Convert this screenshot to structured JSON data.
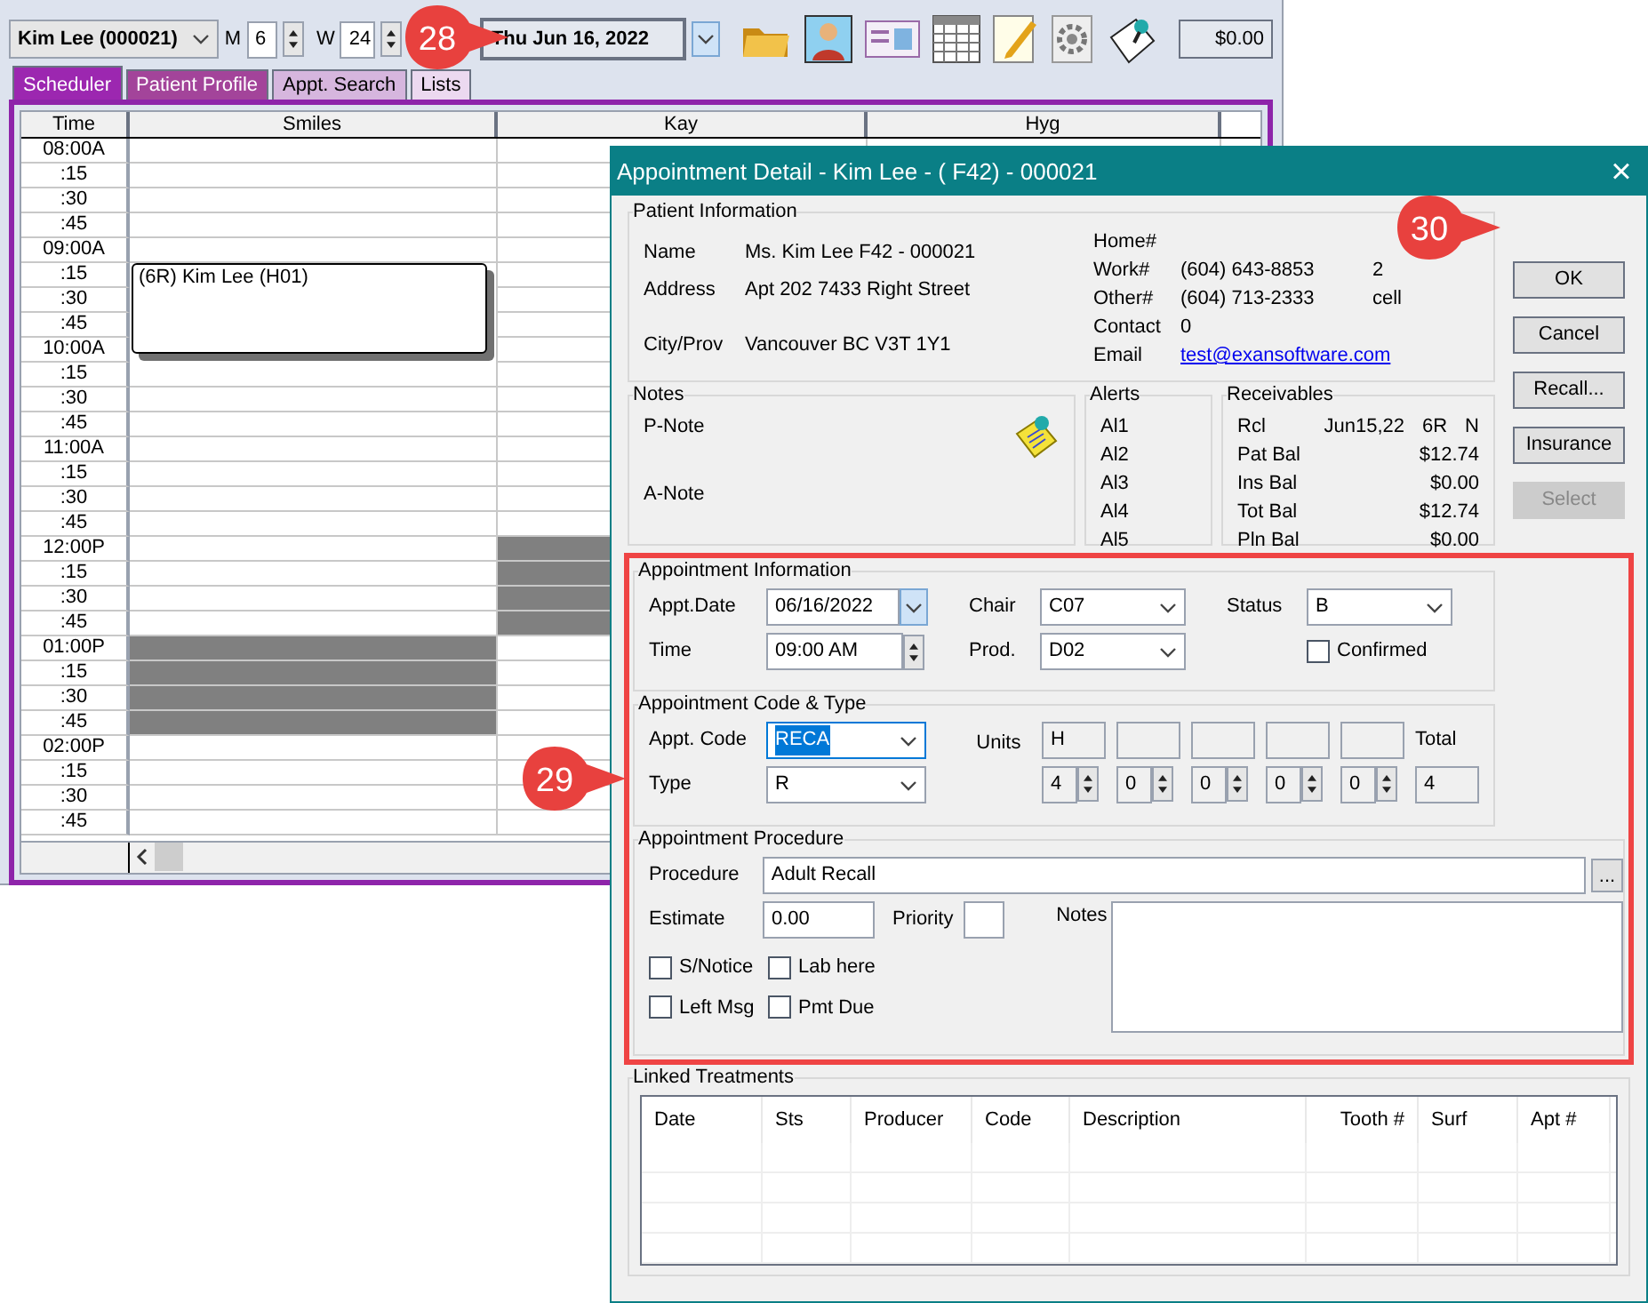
{
  "scheduler": {
    "patient_select": "Kim Lee (000021)",
    "m_label": "M",
    "m_value": "6",
    "w_label": "W",
    "w_value": "24",
    "date": "Thu  Jun 16, 2022",
    "balance": "$0.00",
    "tabs": [
      {
        "label": "Scheduler",
        "selected": true,
        "color": "#9c27b0"
      },
      {
        "label": "Patient Profile",
        "selected": false,
        "color": "#a3449a"
      },
      {
        "label": "Appt. Search",
        "selected": false,
        "color": "#d6b6de"
      },
      {
        "label": "Lists",
        "selected": false,
        "color": "#ecd9f0"
      }
    ],
    "columns": [
      "Time",
      "Smiles",
      "Kay",
      "Hyg"
    ],
    "rows": [
      {
        "time": "08:00A",
        "slots": [
          {
            "kind": "open"
          },
          {
            "kind": "open"
          }
        ]
      },
      {
        "time": ":15",
        "slots": [
          {
            "kind": "open"
          },
          {
            "kind": "open"
          }
        ]
      },
      {
        "time": ":30",
        "slots": [
          {
            "kind": "open"
          },
          {
            "kind": "open"
          }
        ]
      },
      {
        "time": ":45",
        "slots": [
          {
            "kind": "open"
          },
          {
            "kind": "open"
          }
        ]
      },
      {
        "time": "09:00A",
        "slots": [
          {
            "kind": "open"
          },
          {
            "kind": "open"
          }
        ]
      },
      {
        "time": ":15",
        "slots": [
          {
            "kind": "appointment",
            "text": "(6R) Kim Lee (H01)"
          },
          {
            "kind": "open"
          }
        ]
      },
      {
        "time": ":30",
        "slots": [
          {
            "kind": "continued"
          },
          {
            "kind": "open"
          }
        ]
      },
      {
        "time": ":45",
        "slots": [
          {
            "kind": "continued"
          },
          {
            "kind": "open"
          }
        ]
      },
      {
        "time": "10:00A",
        "slots": [
          {
            "kind": "continued"
          },
          {
            "kind": "open"
          }
        ]
      },
      {
        "time": ":15",
        "slots": [
          {
            "kind": "open"
          },
          {
            "kind": "open"
          }
        ]
      },
      {
        "time": ":30",
        "slots": [
          {
            "kind": "open"
          },
          {
            "kind": "open"
          }
        ]
      },
      {
        "time": ":45",
        "slots": [
          {
            "kind": "open"
          },
          {
            "kind": "open"
          }
        ]
      },
      {
        "time": "11:00A",
        "slots": [
          {
            "kind": "open"
          },
          {
            "kind": "open"
          }
        ]
      },
      {
        "time": ":15",
        "slots": [
          {
            "kind": "open"
          },
          {
            "kind": "open"
          }
        ]
      },
      {
        "time": ":30",
        "slots": [
          {
            "kind": "open"
          },
          {
            "kind": "open"
          }
        ]
      },
      {
        "time": ":45",
        "slots": [
          {
            "kind": "open"
          },
          {
            "kind": "open"
          }
        ]
      },
      {
        "time": "12:00P",
        "slots": [
          {
            "kind": "open"
          },
          {
            "kind": "blocked"
          }
        ]
      },
      {
        "time": ":15",
        "slots": [
          {
            "kind": "open"
          },
          {
            "kind": "blocked"
          }
        ]
      },
      {
        "time": ":30",
        "slots": [
          {
            "kind": "open"
          },
          {
            "kind": "blocked"
          }
        ]
      },
      {
        "time": ":45",
        "slots": [
          {
            "kind": "open"
          },
          {
            "kind": "blocked"
          }
        ]
      },
      {
        "time": "01:00P",
        "slots": [
          {
            "kind": "blocked"
          },
          {
            "kind": "open"
          }
        ]
      },
      {
        "time": ":15",
        "slots": [
          {
            "kind": "blocked"
          },
          {
            "kind": "open"
          }
        ]
      },
      {
        "time": ":30",
        "slots": [
          {
            "kind": "blocked"
          },
          {
            "kind": "open"
          }
        ]
      },
      {
        "time": ":45",
        "slots": [
          {
            "kind": "blocked"
          },
          {
            "kind": "open"
          }
        ]
      },
      {
        "time": "02:00P",
        "slots": [
          {
            "kind": "open"
          },
          {
            "kind": "open"
          }
        ]
      },
      {
        "time": ":15",
        "slots": [
          {
            "kind": "open"
          },
          {
            "kind": "open"
          }
        ]
      },
      {
        "time": ":30",
        "slots": [
          {
            "kind": "open"
          },
          {
            "kind": "open"
          }
        ]
      },
      {
        "time": ":45",
        "slots": [
          {
            "kind": "open"
          },
          {
            "kind": "open"
          }
        ]
      }
    ]
  },
  "dialog": {
    "title": "Appointment Detail - Kim Lee - ( F42) - 000021",
    "patient_info": {
      "title": "Patient Information",
      "left": [
        {
          "label": "Name",
          "value": "Ms. Kim Lee  F42 - 000021"
        },
        {
          "label": "Address",
          "value": "Apt 202 7433 Right Street"
        },
        {
          "label": "City/Prov",
          "value": "Vancouver BC V3T 1Y1"
        }
      ],
      "right": [
        {
          "label": "Home#"
        },
        {
          "label": "Work#",
          "value": "(604) 643-8853",
          "extra": "2"
        },
        {
          "label": "Other#",
          "value": "(604) 713-2333",
          "extra": "cell"
        },
        {
          "label": "Contact",
          "value": "0"
        },
        {
          "label": "Email",
          "value": "test@exansoftware.com",
          "kind": "link"
        }
      ]
    },
    "notes": {
      "title": "Notes",
      "items": [
        "P-Note",
        "A-Note"
      ]
    },
    "alerts": {
      "title": "Alerts",
      "items": [
        "Al1",
        "Al2",
        "Al3",
        "Al4",
        "Al5"
      ]
    },
    "receivables": {
      "title": "Receivables",
      "rcl": {
        "label": "Rcl",
        "date": "Jun15,22",
        "code": "6R",
        "flag": "N"
      },
      "rows": [
        {
          "label": "Pat Bal",
          "value": "$12.74"
        },
        {
          "label": "Ins Bal",
          "value": "$0.00"
        },
        {
          "label": "Tot Bal",
          "value": "$12.74"
        },
        {
          "label": "Pln Bal",
          "value": "$0.00"
        }
      ]
    },
    "buttons": [
      {
        "label": "OK",
        "disabled": false
      },
      {
        "label": "Cancel",
        "disabled": false
      },
      {
        "label": "Recall...",
        "disabled": false
      },
      {
        "label": "Insurance",
        "disabled": false
      },
      {
        "label": "Select",
        "disabled": true
      }
    ],
    "appt_info": {
      "title": "Appointment Information",
      "date_label": "Appt.Date",
      "date": "06/16/2022",
      "time_label": "Time",
      "time": "09:00 AM",
      "chair_label": "Chair",
      "chair": "C07",
      "prod_label": "Prod.",
      "prod": "D02",
      "status_label": "Status",
      "status": "B",
      "confirmed_label": "Confirmed",
      "confirmed": false
    },
    "code_type": {
      "title": "Appointment Code & Type",
      "code_label": "Appt. Code",
      "code": "RECA",
      "type_label": "Type",
      "type": "R",
      "units_label": "Units",
      "units": [
        {
          "code": "H",
          "count": "4"
        },
        {
          "count": "0"
        },
        {
          "count": "0"
        },
        {
          "count": "0"
        },
        {
          "count": "0"
        }
      ],
      "total_label": "Total",
      "total": "4"
    },
    "procedure": {
      "title": "Appointment Procedure",
      "procedure_label": "Procedure",
      "procedure": "Adult Recall",
      "browse": "...",
      "estimate_label": "Estimate",
      "estimate": "0.00",
      "priority_label": "Priority",
      "notes_label": "Notes",
      "checkboxes": [
        {
          "label": "S/Notice",
          "checked": false
        },
        {
          "label": "Lab here",
          "checked": false
        },
        {
          "label": "Left Msg",
          "checked": false
        },
        {
          "label": "Pmt Due",
          "checked": false
        }
      ]
    },
    "linked": {
      "title": "Linked Treatments",
      "columns": [
        "Date",
        "Sts",
        "Producer",
        "Code",
        "Description",
        "Tooth #",
        "Surf",
        "Apt #"
      ]
    },
    "close": "×"
  },
  "callouts": [
    "28",
    "29",
    "30"
  ]
}
